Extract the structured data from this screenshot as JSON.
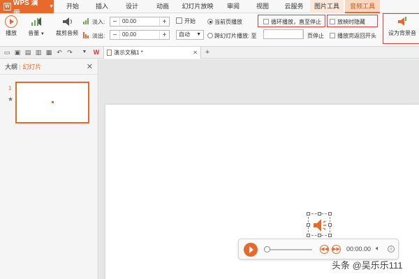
{
  "app": {
    "name": "WPS 演示"
  },
  "menu_tabs": [
    "开始",
    "插入",
    "设计",
    "动画",
    "幻灯片放映",
    "审阅",
    "视图",
    "云服务",
    "图片工具",
    "音频工具"
  ],
  "ribbon": {
    "play_label": "播放",
    "volume_label": "音量",
    "trim_label": "裁剪音频",
    "fade_in_label": "淡入:",
    "fade_in_value": "00.00",
    "fade_out_label": "淡出:",
    "fade_out_value": "00.00",
    "start_label": "开始",
    "start_value": "自动",
    "current_page_label": "当前页播放",
    "cross_slide_label": "跨幻灯片播放: 至",
    "page_stop_label": "页停止",
    "loop_label": "循环播放，直至停止",
    "hide_label": "放映时隐藏",
    "rewind_label": "播放完返回开头",
    "set_bg_music_label": "设为背景音"
  },
  "document_tab": {
    "title": "演示文稿1 *"
  },
  "side_panel": {
    "tab_outline": "大纲",
    "tab_slides": "幻灯片",
    "slide_number": "1"
  },
  "player": {
    "time": "00:00.00"
  },
  "watermark": "头条 @吴乐乐111",
  "colors": {
    "accent": "#e7692c",
    "highlight_box": "#e04040"
  }
}
